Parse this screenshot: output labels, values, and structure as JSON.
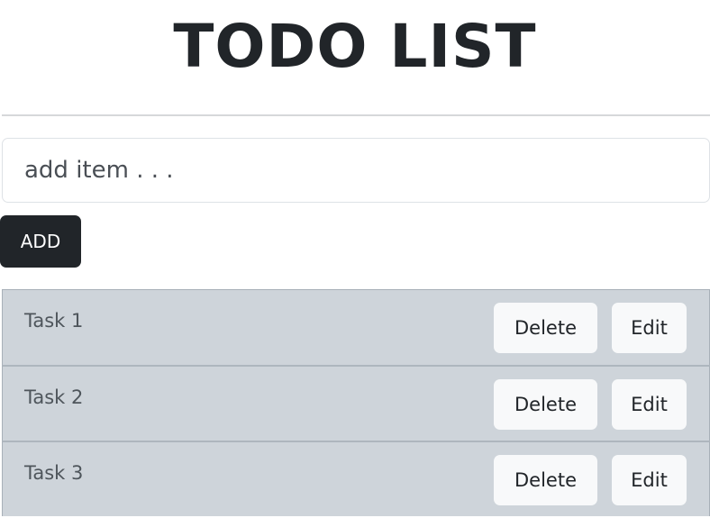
{
  "header": {
    "title": "TODO LIST"
  },
  "form": {
    "placeholder": "add item . . .",
    "add_label": "ADD"
  },
  "tasks": [
    {
      "label": "Task 1",
      "delete_label": "Delete",
      "edit_label": "Edit"
    },
    {
      "label": "Task 2",
      "delete_label": "Delete",
      "edit_label": "Edit"
    },
    {
      "label": "Task 3",
      "delete_label": "Delete",
      "edit_label": "Edit"
    }
  ],
  "colors": {
    "primary_dark": "#212529",
    "row_background": "#ced4da",
    "button_light": "#f8f9fa"
  }
}
